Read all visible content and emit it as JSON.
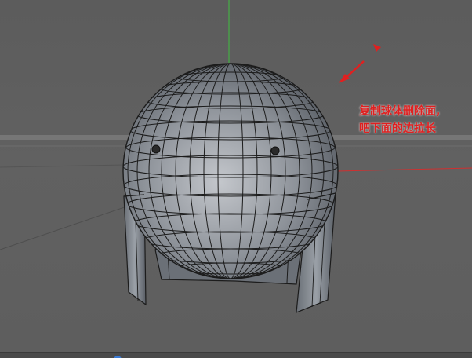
{
  "annotation": {
    "line1": "复制球体删除面,",
    "line2": "吧下面的边拉长"
  },
  "colors": {
    "background": "#5f5f5f",
    "mesh_fill": "#8a8f96",
    "wire": "#1c1c1c",
    "y_axis": "#3fbf3f",
    "x_axis": "#d03030",
    "annotation": "#e02020"
  },
  "icons": [
    "arrow-icon",
    "arrowhead-icon"
  ]
}
